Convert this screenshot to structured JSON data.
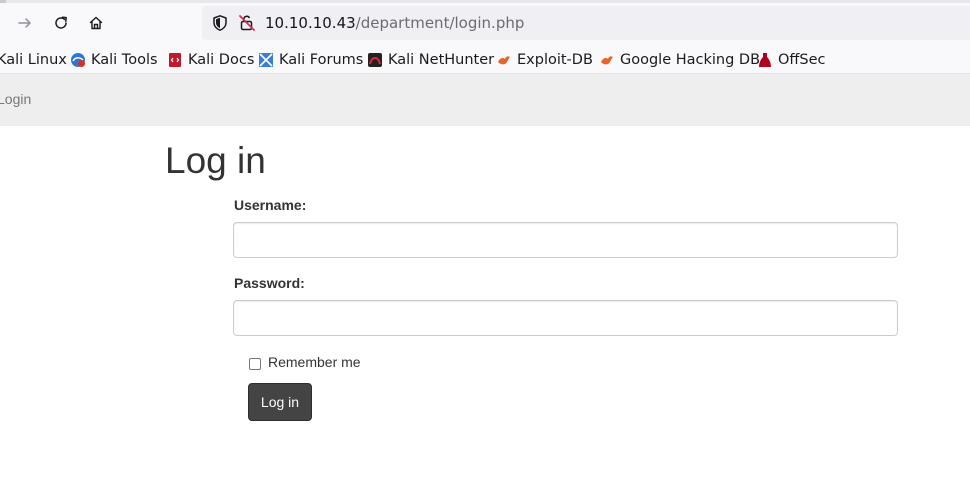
{
  "browser": {
    "url_host": "10.10.10.43",
    "url_path": "/department/login.php",
    "bookmarks": [
      {
        "label": "Kali Linux",
        "icon": "kali-dragon-icon"
      },
      {
        "label": "Kali Tools",
        "icon": "kali-tools-icon"
      },
      {
        "label": "Kali Docs",
        "icon": "kali-docs-icon"
      },
      {
        "label": "Kali Forums",
        "icon": "kali-forums-icon"
      },
      {
        "label": "Kali NetHunter",
        "icon": "kali-nethunter-icon"
      },
      {
        "label": "Exploit-DB",
        "icon": "exploit-db-icon"
      },
      {
        "label": "Google Hacking DB",
        "icon": "google-hacking-db-icon"
      },
      {
        "label": "OffSec",
        "icon": "offsec-icon"
      }
    ]
  },
  "navbar": {
    "brand": "Login"
  },
  "form": {
    "title": "Log in",
    "username_label": "Username:",
    "username_value": "",
    "password_label": "Password:",
    "password_value": "",
    "remember_label": "Remember me",
    "remember_checked": false,
    "submit_label": "Log in"
  },
  "colors": {
    "navbar_bg": "#eeeeee",
    "button_bg": "#444444",
    "exploit_orange": "#e8642c",
    "offsec_red": "#b00020"
  }
}
